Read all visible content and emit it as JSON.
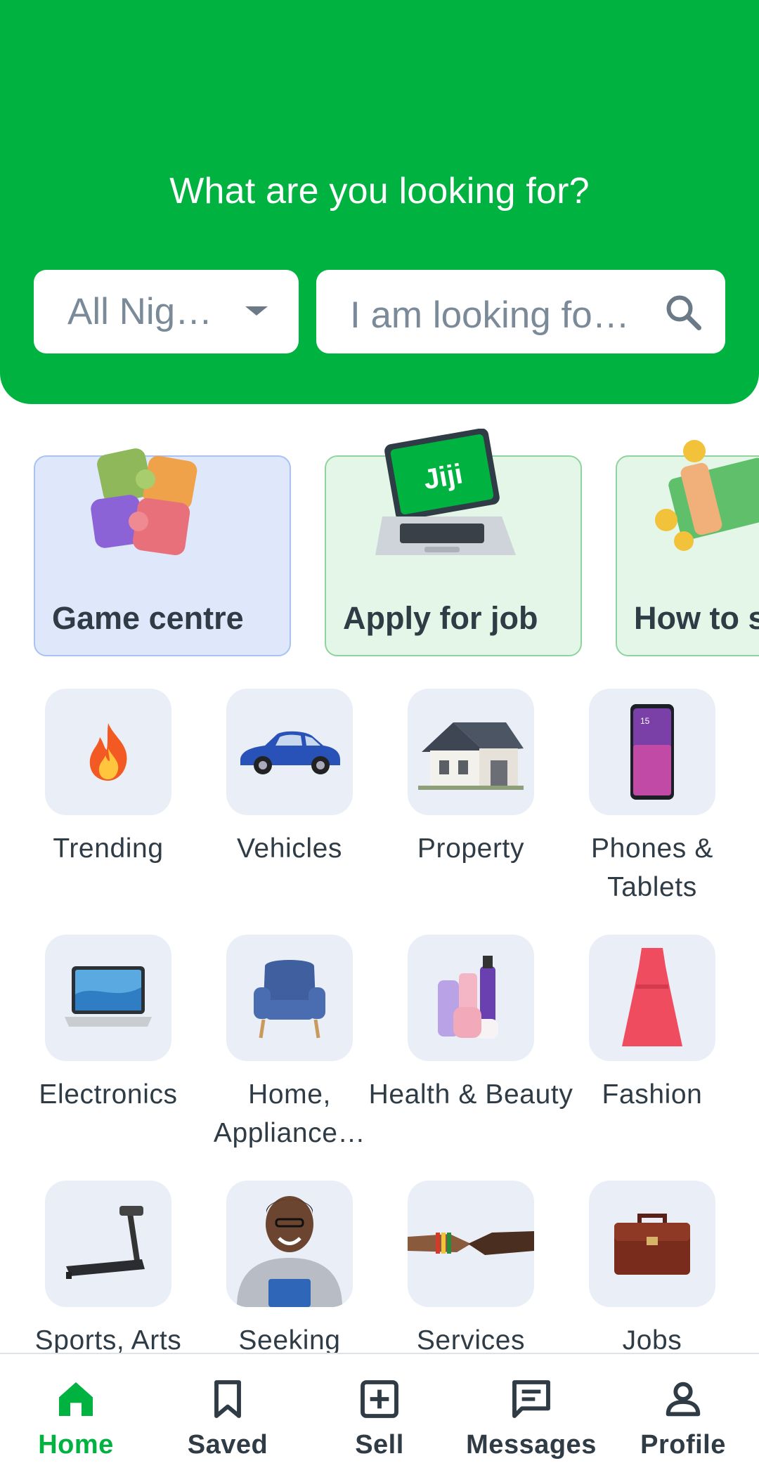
{
  "header": {
    "title": "What are you looking for?",
    "location_value": "All Nigeria",
    "search_placeholder": "I am looking for..."
  },
  "promos": [
    {
      "label": "Game centre",
      "bg": "#dfe8fb",
      "border": "#a9c2f2",
      "icon": "puzzle-icon"
    },
    {
      "label": "Apply for job",
      "bg": "#e3f6e7",
      "border": "#8fd39f",
      "icon": "laptop-jiji-icon",
      "badge": "Jiji"
    },
    {
      "label": "How to sell",
      "bg": "#e3f6e7",
      "border": "#8fd39f",
      "icon": "money-icon"
    }
  ],
  "categories": [
    {
      "label": "Trending",
      "icon": "fire-icon"
    },
    {
      "label": "Vehicles",
      "icon": "car-icon"
    },
    {
      "label": "Property",
      "icon": "house-icon"
    },
    {
      "label": "Phones & Tablets",
      "icon": "phone-icon"
    },
    {
      "label": "Electronics",
      "icon": "laptop-icon"
    },
    {
      "label": "Home, Appliance…",
      "icon": "armchair-icon"
    },
    {
      "label": "Health & Beauty",
      "icon": "cosmetics-icon"
    },
    {
      "label": "Fashion",
      "icon": "dress-icon"
    },
    {
      "label": "Sports, Arts",
      "icon": "treadmill-icon"
    },
    {
      "label": "Seeking",
      "icon": "person-icon"
    },
    {
      "label": "Services",
      "icon": "handshake-icon"
    },
    {
      "label": "Jobs",
      "icon": "briefcase-icon"
    }
  ],
  "nav": [
    {
      "label": "Home",
      "icon": "home-icon",
      "active": true
    },
    {
      "label": "Saved",
      "icon": "bookmark-icon"
    },
    {
      "label": "Sell",
      "icon": "plus-box-icon"
    },
    {
      "label": "Messages",
      "icon": "message-icon"
    },
    {
      "label": "Profile",
      "icon": "profile-icon"
    }
  ],
  "colors": {
    "brand_green": "#00b23f",
    "tile_bg": "#eaeff7",
    "text": "#2f3b45",
    "muted": "#7a8a99"
  }
}
